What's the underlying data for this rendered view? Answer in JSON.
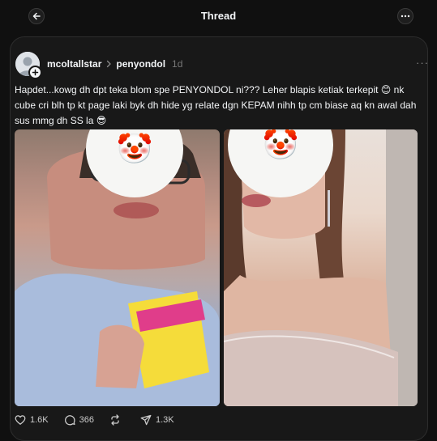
{
  "header": {
    "title": "Thread",
    "back_icon": "arrow-left-icon",
    "more_icon": "ellipsis-icon"
  },
  "post": {
    "username": "mcoltallstar",
    "reply_to": "penyondol",
    "timestamp": "1d",
    "text": "Hapdet...kowg dh dpt teka blom spe PENYONDOL ni??? Leher blapis ketiak terkepit 😊 nk cube cri blh tp kt page laki byk dh hide yg relate dgn KEPAM nihh tp cm biase aq kn awal dah sus mmg dh SS la 😎",
    "images": [
      {
        "face_cover": "🤡"
      },
      {
        "face_cover": "🤡"
      }
    ],
    "stats": {
      "likes": "1.6K",
      "replies": "366",
      "reposts": "",
      "shares": "1.3K"
    }
  },
  "colors": {
    "background": "#101010",
    "card": "#181818",
    "border": "#2d2d2d",
    "text": "#f3f5f7",
    "muted": "#777777"
  }
}
